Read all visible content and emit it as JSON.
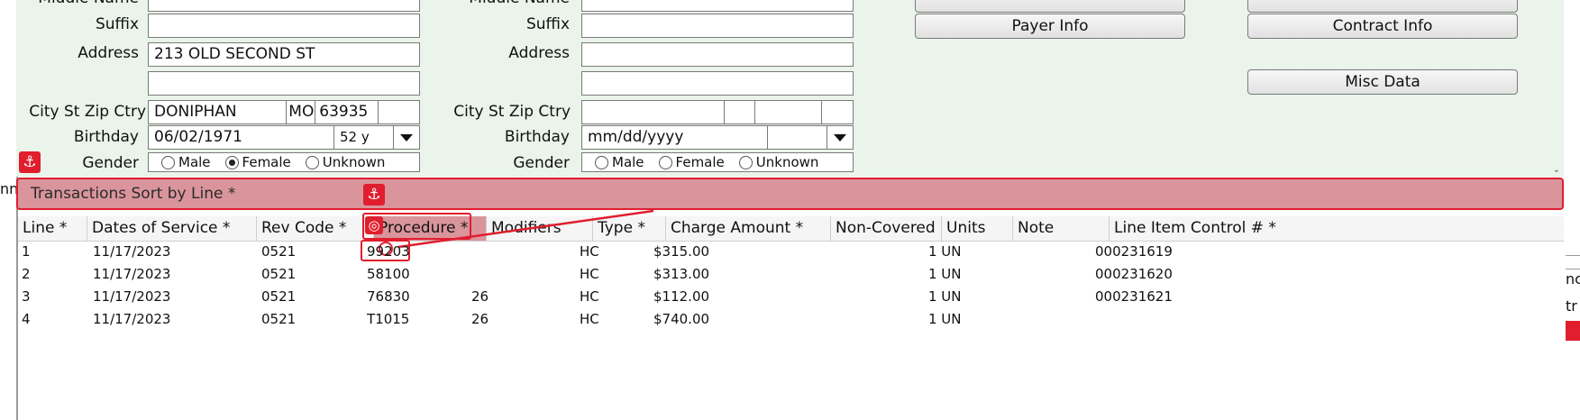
{
  "patient": {
    "middle_name_label": "Middle Name",
    "suffix_label": "Suffix",
    "address_label": "Address",
    "address_line1": "213 OLD SECOND ST",
    "address_line2": "",
    "city_label": "City St Zip Ctry",
    "city": "DONIPHAN",
    "state": "MO",
    "zip": "63935",
    "country": "",
    "birthday_label": "Birthday",
    "birthday": "06/02/1971",
    "age": "52 y",
    "gender_label": "Gender",
    "gender_options": [
      "Male",
      "Female",
      "Unknown"
    ]
  },
  "insured": {
    "middle_name_label": "Middle Name",
    "suffix_label": "Suffix",
    "address_label": "Address",
    "city_label": "City St Zip Ctry",
    "birthday_label": "Birthday",
    "birthday_placeholder": "mm/dd/yyyy",
    "gender_label": "Gender",
    "gender_options": [
      "Male",
      "Female",
      "Unknown"
    ]
  },
  "buttons": {
    "payer_info": "Payer Info",
    "contract_info": "Contract Info",
    "misc_data": "Misc Data"
  },
  "transactions": {
    "title": "Transactions Sort by Line *",
    "columns": [
      "Line *",
      "Dates of Service *",
      "Rev Code *",
      "Procedure *",
      "Modifiers",
      "Type *",
      "Charge Amount *",
      "Non-Covered",
      "Units",
      "Note",
      "Line Item Control # *"
    ],
    "rows": [
      {
        "line": "1",
        "dos": "11/17/2023",
        "rev": "0521",
        "proc": "99203",
        "mod": "",
        "type": "HC",
        "charge": "$315.00",
        "noncov": "",
        "units": "1 UN",
        "note": "",
        "lic": "000231619"
      },
      {
        "line": "2",
        "dos": "11/17/2023",
        "rev": "0521",
        "proc": "58100",
        "mod": "",
        "type": "HC",
        "charge": "$313.00",
        "noncov": "",
        "units": "1 UN",
        "note": "",
        "lic": "000231620"
      },
      {
        "line": "3",
        "dos": "11/17/2023",
        "rev": "0521",
        "proc": "76830",
        "mod": "26",
        "type": "HC",
        "charge": "$112.00",
        "noncov": "",
        "units": "1 UN",
        "note": "",
        "lic": "000231621"
      },
      {
        "line": "4",
        "dos": "11/17/2023",
        "rev": "0521",
        "proc": "T1015",
        "mod": "26",
        "type": "HC",
        "charge": "$740.00",
        "noncov": "",
        "units": "1 UN",
        "note": "",
        "lic": ""
      }
    ]
  },
  "side_fragments": {
    "left": "nn",
    "right_1": "nc",
    "right_2": "tr"
  },
  "colors": {
    "form_bg": "#eaf4ea",
    "section_bar": "#d9959b",
    "highlight": "#e01e2e"
  }
}
